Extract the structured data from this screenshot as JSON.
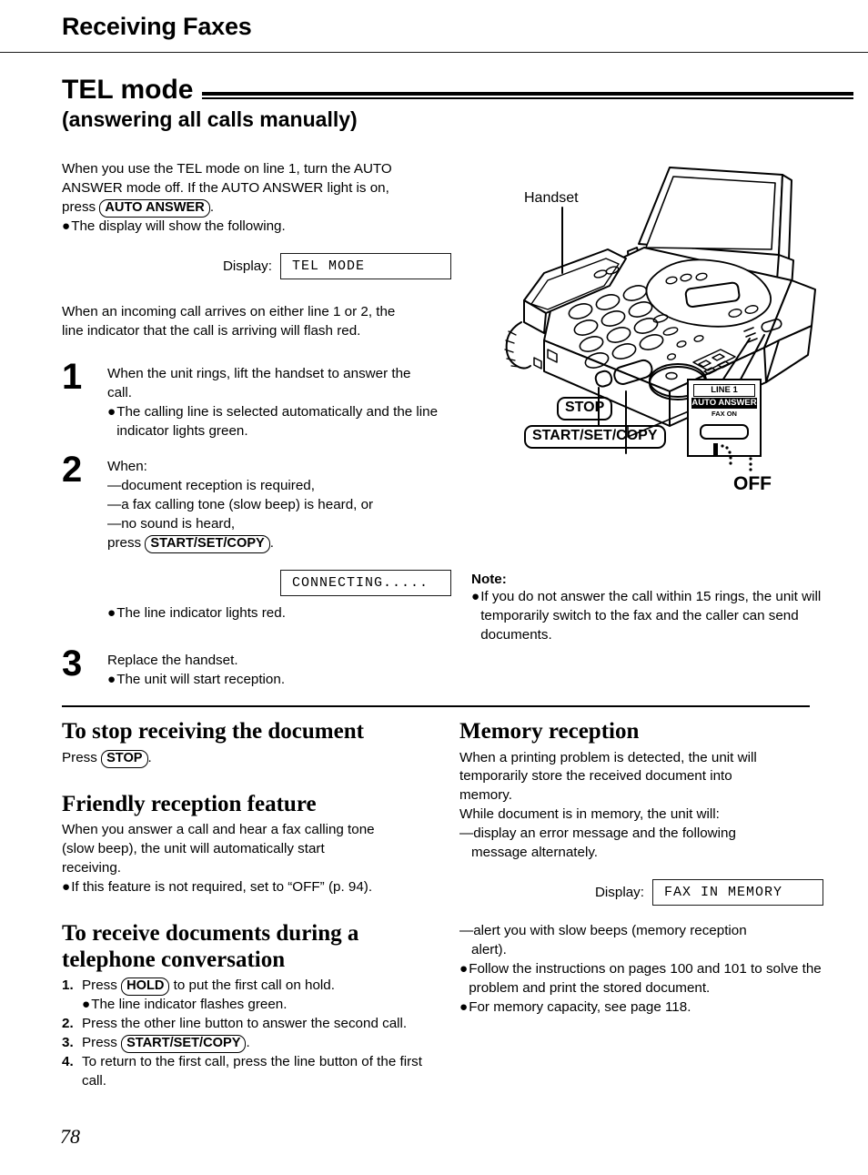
{
  "page": {
    "running_head": "Receiving Faxes",
    "folio": "78"
  },
  "section": {
    "title": "TEL mode",
    "subtitle": "(answering all calls manually)"
  },
  "intro": {
    "line1": "When you use the TEL mode on line 1, turn the AUTO",
    "line2": "ANSWER mode off. If the AUTO ANSWER light is on,",
    "press_word": "press",
    "key_auto_answer": "AUTO ANSWER",
    "period": ".",
    "bullet_dot": "●",
    "bullet1": "The display will show the following."
  },
  "display1": {
    "label": "Display:",
    "value": "TEL MODE"
  },
  "incoming": {
    "line1": "When an incoming call arrives on either line 1 or 2, the",
    "line2": "line indicator that the call is arriving will flash red."
  },
  "steps": [
    {
      "num": "1",
      "body_line1": "When the unit rings, lift the handset to answer the",
      "body_line2": "call.",
      "bullet": "The calling line is selected automatically and the line indicator lights green."
    },
    {
      "num": "2",
      "lead": "When:",
      "dashes": [
        "—document reception is required,",
        "—a fax calling tone (slow beep) is heard, or",
        "—no sound is heard,"
      ],
      "press_word": "press",
      "key": "START/SET/COPY",
      "period": ".",
      "bullet": "The line indicator lights red."
    },
    {
      "num": "3",
      "body_line1": "Replace the handset.",
      "bullet": "The unit will start reception."
    }
  ],
  "display2": {
    "value": "CONNECTING....."
  },
  "illustration": {
    "handset_label": "Handset",
    "stop_key": "STOP",
    "startsetcopy_key": "START/SET/COPY",
    "panel": {
      "line1": "LINE 1",
      "auto_answer": "AUTO ANSWER",
      "fax_on": "FAX ON"
    },
    "off_label": "OFF"
  },
  "note": {
    "title": "Note:",
    "bullet_dot": "●",
    "text_line1": "If you do not answer the call within 15 rings,",
    "text_line2": "the unit will temporarily switch to the fax and",
    "text_line3": "the caller can send documents."
  },
  "bottom_left": {
    "stop_heading": "To stop receiving the document",
    "stop_press_word": "Press",
    "stop_key": "STOP",
    "stop_period": ".",
    "friendly_heading": "Friendly reception feature",
    "friendly_line1": "When you answer a call and hear a fax calling tone",
    "friendly_line2": "(slow beep), the unit will automatically start",
    "friendly_line3": "receiving.",
    "friendly_bullet": "If this feature is not required, set to “OFF” (p. 94).",
    "receive_heading_line1": "To receive documents during a",
    "receive_heading_line2": "telephone conversation",
    "list": [
      {
        "n": "1.",
        "pre": "Press",
        "key": "HOLD",
        "post": "to put the first call on hold.",
        "bullet": "The line indicator flashes green."
      },
      {
        "n": "2.",
        "pre": "Press the other line button to answer the second call.",
        "key": "",
        "post": "",
        "bullet": ""
      },
      {
        "n": "3.",
        "pre": "Press",
        "key": "START/SET/COPY",
        "post": ".",
        "bullet": ""
      },
      {
        "n": "4.",
        "pre": "To return to the first call, press the line button of the first call.",
        "key": "",
        "post": "",
        "bullet": ""
      }
    ]
  },
  "bottom_right": {
    "heading": "Memory reception",
    "para_line1": "When a printing problem is detected, the unit will",
    "para_line2": "temporarily store the received document into",
    "para_line3": "memory.",
    "para_line4": "While document is in memory, the unit will:",
    "dash_line1": "—display an error message and the following",
    "dash_line2": "message alternately.",
    "display_label": "Display:",
    "display_value": "FAX IN MEMORY",
    "dash2_line1": "—alert you with slow beeps (memory reception",
    "dash2_line2": "alert).",
    "bullet1_line1": "Follow the instructions on pages 100 and 101 to",
    "bullet1_line2": "solve the problem and print the stored document.",
    "bullet2": "For memory capacity, see page 118."
  },
  "colors": {
    "ink": "#000000",
    "paper": "#ffffff",
    "rule": "#1a1a1a"
  }
}
